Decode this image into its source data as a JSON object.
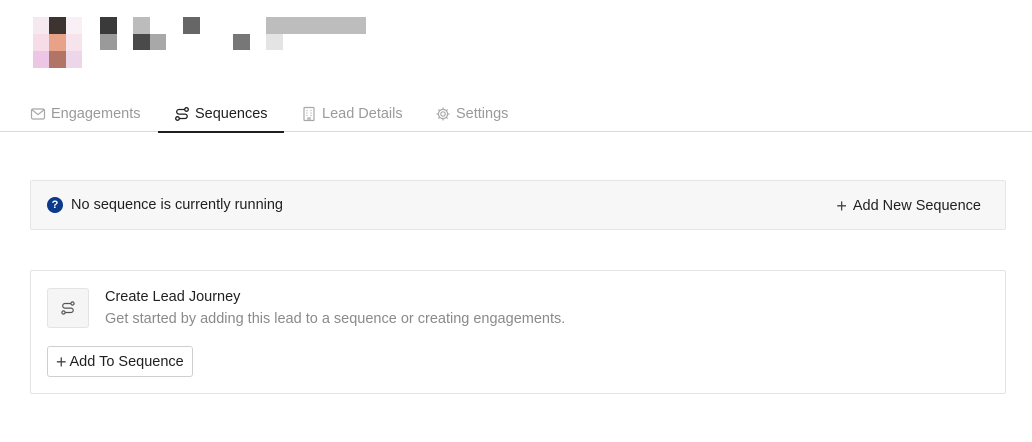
{
  "tabs": [
    {
      "label": "Engagements",
      "icon": "mail-icon",
      "active": false
    },
    {
      "label": "Sequences",
      "icon": "sequence-icon",
      "active": true
    },
    {
      "label": "Lead Details",
      "icon": "building-icon",
      "active": false
    },
    {
      "label": "Settings",
      "icon": "gear-icon",
      "active": false
    }
  ],
  "banner": {
    "icon": "help-icon",
    "help_glyph": "?",
    "message": "No sequence is currently running",
    "action_label": "Add New Sequence"
  },
  "journey": {
    "icon": "sequence-icon",
    "title": "Create Lead Journey",
    "subtitle": "Get started by adding this lead to a sequence or creating engagements.",
    "button_label": "Add To Sequence"
  },
  "colors": {
    "accent": "#0b3a8a",
    "text": "#1f1f1f",
    "muted": "#9a9a9a",
    "banner_bg": "#f7f7f7"
  }
}
